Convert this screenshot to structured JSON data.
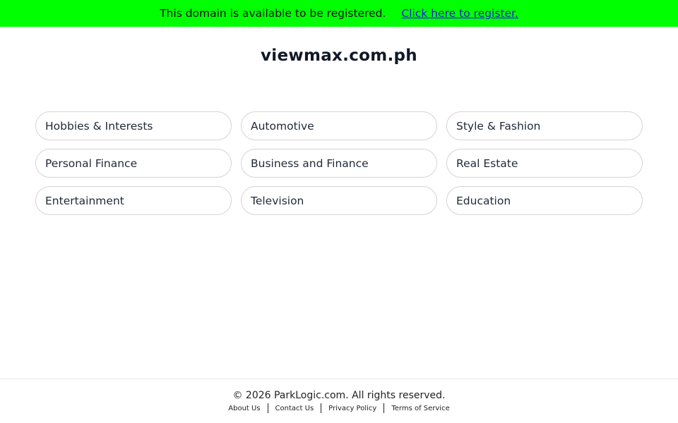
{
  "banner": {
    "text": "This domain is available to be registered.",
    "link_label": "Click here to register.",
    "color": "#00ff00"
  },
  "domain": "viewmax.com.ph",
  "categories": [
    "Hobbies & Interests",
    "Automotive",
    "Style & Fashion",
    "Personal Finance",
    "Business and Finance",
    "Real Estate",
    "Entertainment",
    "Television",
    "Education"
  ],
  "footer": {
    "copyright": "© 2026 ParkLogic.com. All rights reserved.",
    "links": [
      "About Us",
      "Contact Us",
      "Privacy Policy",
      "Terms of Service"
    ]
  }
}
